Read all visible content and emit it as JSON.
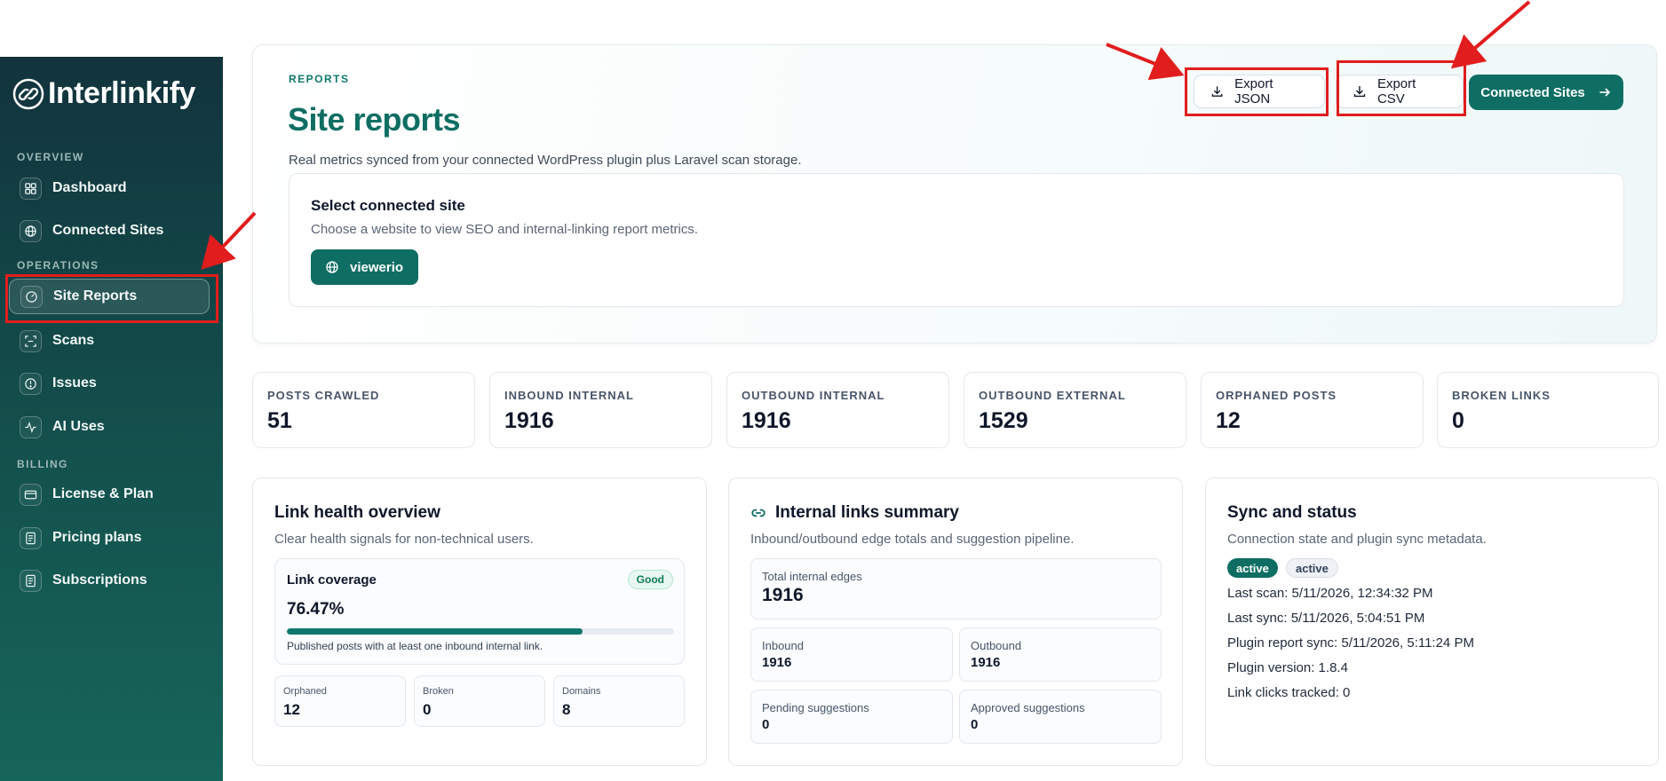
{
  "brand": {
    "name": "Interlinkify"
  },
  "sidebar": {
    "sections": [
      {
        "label": "OVERVIEW"
      },
      {
        "label": "OPERATIONS"
      },
      {
        "label": "BILLING"
      }
    ],
    "items": [
      {
        "label": "Dashboard",
        "icon": "grid-icon"
      },
      {
        "label": "Connected Sites",
        "icon": "globe-icon"
      },
      {
        "label": "Site Reports",
        "icon": "gauge-icon",
        "active": true
      },
      {
        "label": "Scans",
        "icon": "scan-icon"
      },
      {
        "label": "Issues",
        "icon": "alert-icon"
      },
      {
        "label": "AI Uses",
        "icon": "activity-icon"
      },
      {
        "label": "License & Plan",
        "icon": "card-icon"
      },
      {
        "label": "Pricing plans",
        "icon": "document-icon"
      },
      {
        "label": "Subscriptions",
        "icon": "document-icon"
      }
    ]
  },
  "header": {
    "eyebrow": "REPORTS",
    "title": "Site reports",
    "subtitle": "Real metrics synced from your connected WordPress plugin plus Laravel scan storage.",
    "export_json": "Export JSON",
    "export_csv": "Export CSV",
    "connected_sites": "Connected Sites"
  },
  "site_select": {
    "title": "Select connected site",
    "subtitle": "Choose a website to view SEO and internal-linking report metrics.",
    "selected": "viewerio"
  },
  "stats": [
    {
      "label": "POSTS CRAWLED",
      "value": "51"
    },
    {
      "label": "INBOUND INTERNAL",
      "value": "1916"
    },
    {
      "label": "OUTBOUND INTERNAL",
      "value": "1916"
    },
    {
      "label": "OUTBOUND EXTERNAL",
      "value": "1529"
    },
    {
      "label": "ORPHANED POSTS",
      "value": "12"
    },
    {
      "label": "BROKEN LINKS",
      "value": "0"
    }
  ],
  "link_health": {
    "title": "Link health overview",
    "subtitle": "Clear health signals for non-technical users.",
    "coverage_label": "Link coverage",
    "badge": "Good",
    "coverage_value": "76.47%",
    "coverage_fraction": 0.7647,
    "note": "Published posts with at least one inbound internal link.",
    "mini": [
      {
        "label": "Orphaned",
        "value": "12"
      },
      {
        "label": "Broken",
        "value": "0"
      },
      {
        "label": "Domains",
        "value": "8"
      }
    ]
  },
  "internal_links": {
    "title": "Internal links summary",
    "subtitle": "Inbound/outbound edge totals and suggestion pipeline.",
    "total_label": "Total internal edges",
    "total_value": "1916",
    "inbound_label": "Inbound",
    "inbound_value": "1916",
    "outbound_label": "Outbound",
    "outbound_value": "1916",
    "pending_label": "Pending suggestions",
    "pending_value": "0",
    "approved_label": "Approved suggestions",
    "approved_value": "0"
  },
  "sync_status": {
    "title": "Sync and status",
    "subtitle": "Connection state and plugin sync metadata.",
    "badges": [
      "active",
      "active"
    ],
    "lines": [
      "Last scan: 5/11/2026, 12:34:32 PM",
      "Last sync: 5/11/2026, 5:04:51 PM",
      "Plugin report sync: 5/11/2026, 5:11:24 PM",
      "Plugin version: 1.8.4",
      "Link clicks tracked: 0"
    ]
  },
  "colors": {
    "brand": "#0f6e63",
    "sidebar_top": "#12333d",
    "sidebar_bottom": "#16655a",
    "annotation": "#e11d1d"
  }
}
